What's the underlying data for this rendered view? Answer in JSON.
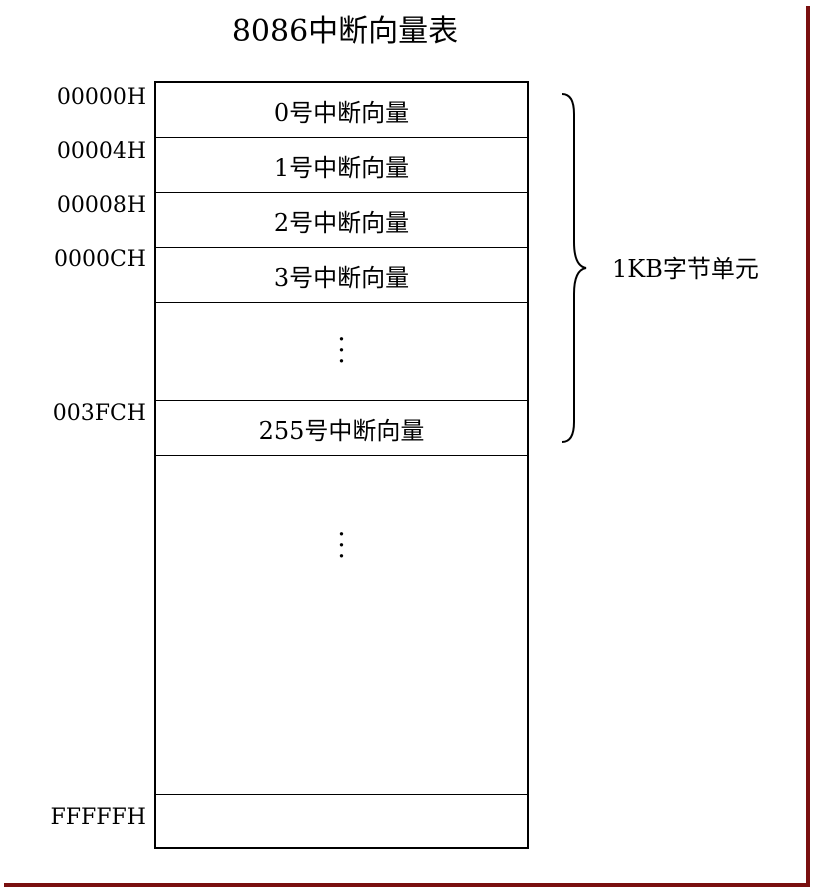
{
  "title": "8086中断向量表",
  "addresses": {
    "a0": "00000H",
    "a1": "00004H",
    "a2": "00008H",
    "a3": "0000CH",
    "a255": "003FCH",
    "end": "FFFFFH"
  },
  "vectors": {
    "v0": "0号中断向量",
    "v1": "1号中断向量",
    "v2": "2号中断向量",
    "v3": "3号中断向量",
    "v255": "255号中断向量"
  },
  "brace_label": "1KB字节单元",
  "colors": {
    "frame": "#7a1010",
    "line": "#000000",
    "background": "#ffffff"
  }
}
